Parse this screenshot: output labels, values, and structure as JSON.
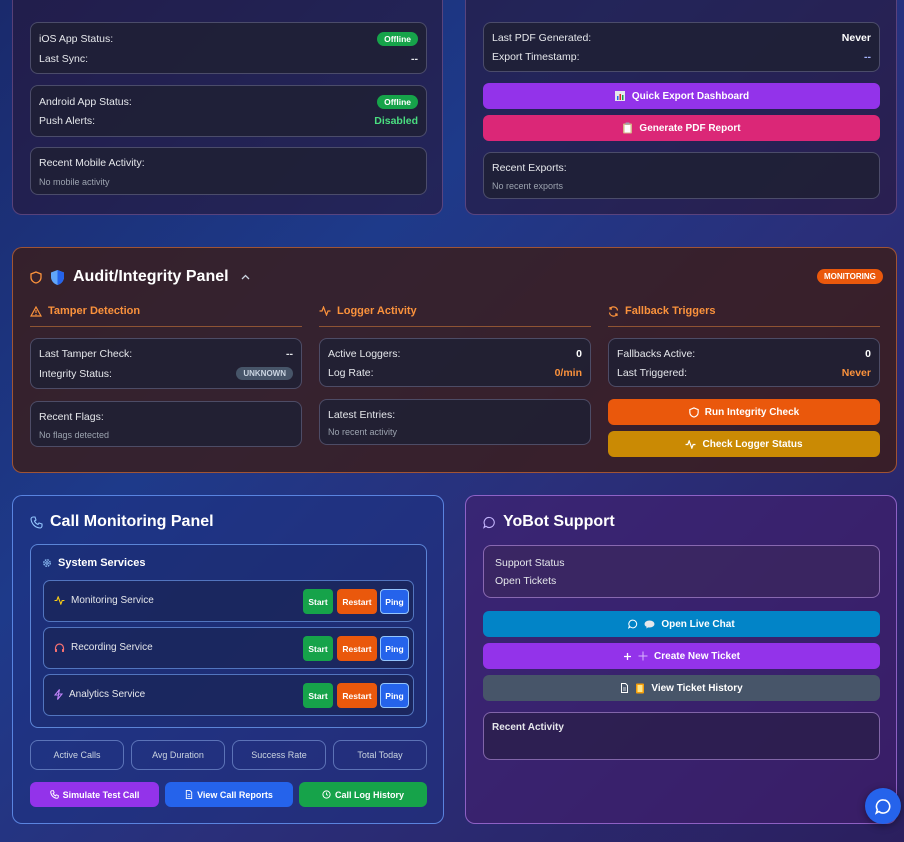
{
  "mobile": {
    "ios_label": "iOS App Status:",
    "ios_status": "Offline",
    "last_sync_label": "Last Sync:",
    "last_sync_value": "--",
    "android_label": "Android App Status:",
    "android_status": "Offline",
    "push_label": "Push Alerts:",
    "push_value": "Disabled",
    "recent_label": "Recent Mobile Activity:",
    "recent_value": "No mobile activity"
  },
  "export": {
    "last_pdf_label": "Last PDF Generated:",
    "last_pdf_value": "Never",
    "timestamp_label": "Export Timestamp:",
    "timestamp_value": "--",
    "quick_export_label": "Quick Export Dashboard",
    "generate_pdf_label": "Generate PDF Report",
    "recent_label": "Recent Exports:",
    "recent_value": "No recent exports"
  },
  "audit": {
    "title": "Audit/Integrity Panel",
    "badge": "MONITORING",
    "tamper": {
      "title": "Tamper Detection",
      "last_check_label": "Last Tamper Check:",
      "last_check_value": "--",
      "integrity_label": "Integrity Status:",
      "integrity_value": "UNKNOWN",
      "flags_label": "Recent Flags:",
      "flags_value": "No flags detected"
    },
    "logger": {
      "title": "Logger Activity",
      "active_label": "Active Loggers:",
      "active_value": "0",
      "rate_label": "Log Rate:",
      "rate_value": "0/min",
      "entries_label": "Latest Entries:",
      "entries_value": "No recent activity"
    },
    "fallback": {
      "title": "Fallback Triggers",
      "active_label": "Fallbacks Active:",
      "active_value": "0",
      "last_label": "Last Triggered:",
      "last_value": "Never",
      "run_integrity_label": "Run Integrity Check",
      "check_logger_label": "Check Logger Status"
    }
  },
  "calls": {
    "title": "Call Monitoring Panel",
    "services_title": "System Services",
    "services": [
      {
        "name": "Monitoring Service",
        "icon": "activity-icon"
      },
      {
        "name": "Recording Service",
        "icon": "headphones-icon"
      },
      {
        "name": "Analytics Service",
        "icon": "zap-icon"
      }
    ],
    "start_label": "Start",
    "restart_label": "Restart",
    "ping_label": "Ping",
    "stats": [
      "Active Calls",
      "Avg Duration",
      "Success Rate",
      "Total Today"
    ],
    "simulate_label": "Simulate Test Call",
    "reports_label": "View Call Reports",
    "history_label": "Call Log History"
  },
  "support": {
    "title": "YoBot Support",
    "status_label": "Support Status",
    "tickets_label": "Open Tickets",
    "live_chat_label": "Open Live Chat",
    "new_ticket_label": "Create New Ticket",
    "ticket_history_label": "View Ticket History",
    "recent_activity_label": "Recent Activity"
  },
  "colors": {
    "offline_green": "#16a34a",
    "disabled_green": "#4ade80",
    "purple": "#9333ea",
    "pink": "#db2777",
    "orange": "#ea580c",
    "amber": "#ca8a04",
    "blue": "#2563eb",
    "sky": "#0284c7",
    "slate": "#475569"
  }
}
